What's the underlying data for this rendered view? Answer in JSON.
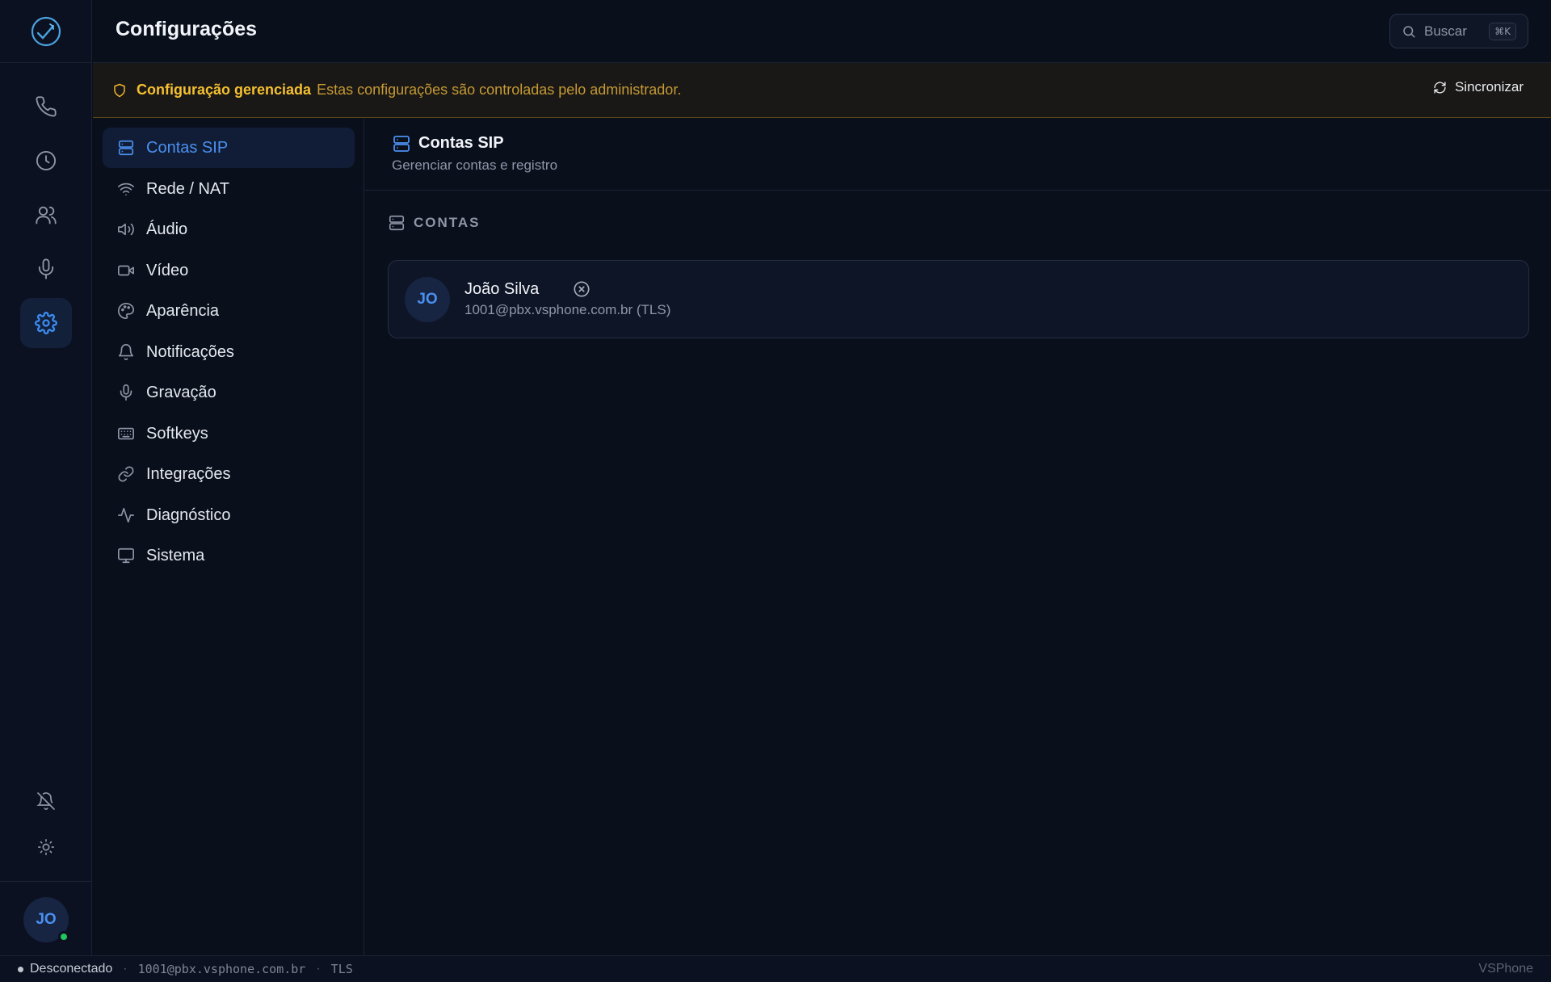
{
  "header": {
    "title": "Configurações",
    "search_label": "Buscar",
    "search_shortcut": "⌘K"
  },
  "rail": {
    "items": [
      {
        "name": "calls",
        "icon": "phone-icon"
      },
      {
        "name": "history",
        "icon": "clock-icon"
      },
      {
        "name": "contacts",
        "icon": "users-icon"
      },
      {
        "name": "recordings",
        "icon": "microphone-icon"
      },
      {
        "name": "settings",
        "icon": "gear-icon",
        "active": true
      }
    ],
    "bottom": [
      {
        "name": "notifications-off",
        "icon": "bell-off-icon"
      },
      {
        "name": "theme",
        "icon": "sun-icon"
      }
    ],
    "avatar_initials": "JO",
    "presence_color": "#22c55e"
  },
  "banner": {
    "strong": "Configuração gerenciada",
    "text": "Estas configurações são controladas pelo administrador.",
    "sync_label": "Sincronizar"
  },
  "nav": {
    "items": [
      {
        "label": "Contas SIP",
        "icon": "server-icon",
        "active": true
      },
      {
        "label": "Rede / NAT",
        "icon": "wifi-icon"
      },
      {
        "label": "Áudio",
        "icon": "speaker-icon"
      },
      {
        "label": "Vídeo",
        "icon": "video-icon"
      },
      {
        "label": "Aparência",
        "icon": "palette-icon"
      },
      {
        "label": "Notificações",
        "icon": "bell-icon"
      },
      {
        "label": "Gravação",
        "icon": "microphone-icon"
      },
      {
        "label": "Softkeys",
        "icon": "keyboard-icon"
      },
      {
        "label": "Integrações",
        "icon": "link-icon"
      },
      {
        "label": "Diagnóstico",
        "icon": "activity-icon"
      },
      {
        "label": "Sistema",
        "icon": "monitor-icon"
      }
    ]
  },
  "main": {
    "title": "Contas SIP",
    "subtitle": "Gerenciar contas e registro",
    "section_label": "CONTAS",
    "account": {
      "initials": "JO",
      "name": "João Silva",
      "address": "1001@pbx.vsphone.com.br (TLS)",
      "status_icon": "x-circle-icon"
    }
  },
  "statusbar": {
    "state": "Desconectado",
    "separator": "·",
    "account": "1001@pbx.vsphone.com.br",
    "transport": "TLS",
    "brand": "VSPhone"
  },
  "colors": {
    "accent": "#3b8bf0",
    "warning": "#f5c030",
    "background": "#0a0f1c"
  }
}
